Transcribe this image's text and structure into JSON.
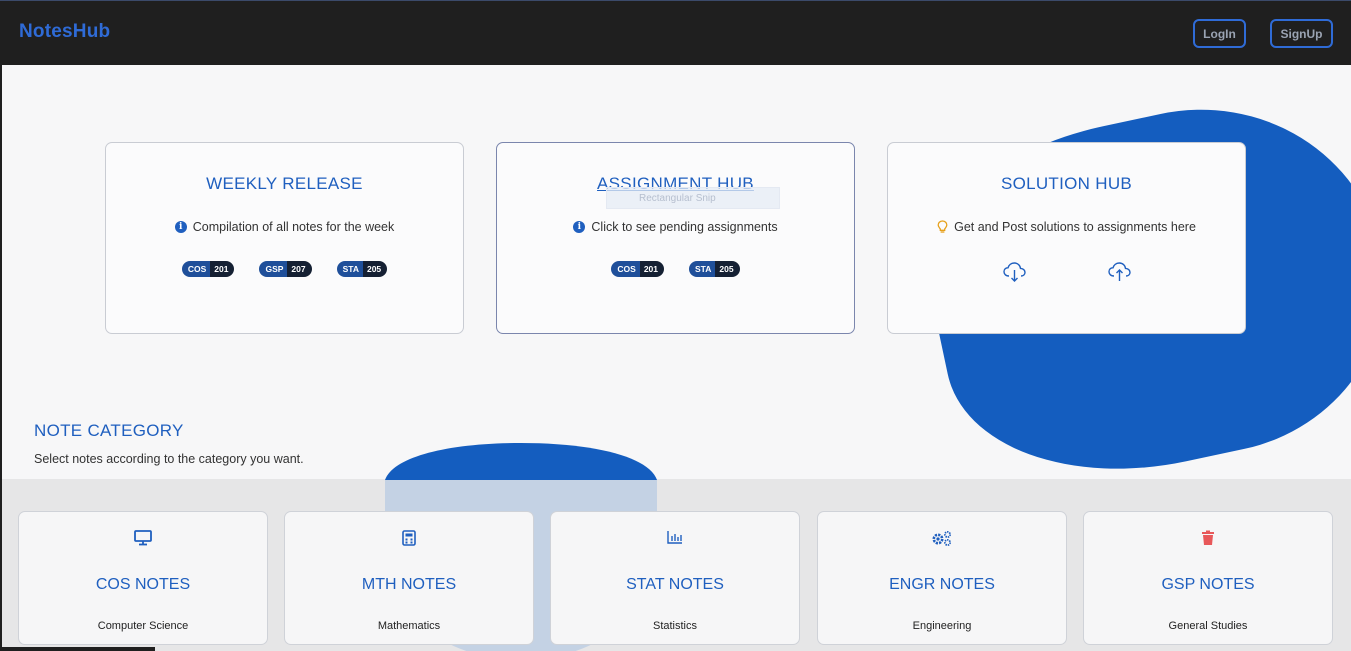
{
  "navbar": {
    "brand": "NotesHub",
    "login_label": "LogIn",
    "signup_label": "SignUp"
  },
  "hubs": [
    {
      "title": "WEEKLY RELEASE",
      "description": "Compilation of all notes for the week",
      "icon": "info-icon",
      "badges": [
        {
          "code": "COS",
          "num": "201"
        },
        {
          "code": "GSP",
          "num": "207"
        },
        {
          "code": "STA",
          "num": "205"
        }
      ]
    },
    {
      "title": "ASSIGNMENT HUB",
      "description": "Click to see pending assignments",
      "icon": "info-icon",
      "badges": [
        {
          "code": "COS",
          "num": "201"
        },
        {
          "code": "STA",
          "num": "205"
        }
      ]
    },
    {
      "title": "SOLUTION HUB",
      "description": "Get and Post solutions to assignments here",
      "icon": "lightbulb-icon",
      "actions": [
        "cloud-download-icon",
        "cloud-upload-icon"
      ]
    }
  ],
  "snip_overlay": "Rectangular Snip",
  "category": {
    "title": "NOTE CATEGORY",
    "subtitle": "Select notes according to the category you want.",
    "items": [
      {
        "title": "COS NOTES",
        "subtitle": "Computer Science",
        "icon": "desktop-icon"
      },
      {
        "title": "MTH NOTES",
        "subtitle": "Mathematics",
        "icon": "calculator-icon"
      },
      {
        "title": "STAT NOTES",
        "subtitle": "Statistics",
        "icon": "bar-chart-icon"
      },
      {
        "title": "ENGR NOTES",
        "subtitle": "Engineering",
        "icon": "gears-icon"
      },
      {
        "title": "GSP NOTES",
        "subtitle": "General Studies",
        "icon": "trash-icon"
      }
    ]
  },
  "colors": {
    "accent": "#1f5fbf",
    "blob": "#145dbf",
    "navbar": "#1f1f1f",
    "trash": "#e8585a",
    "bulb": "#e6a01a"
  }
}
